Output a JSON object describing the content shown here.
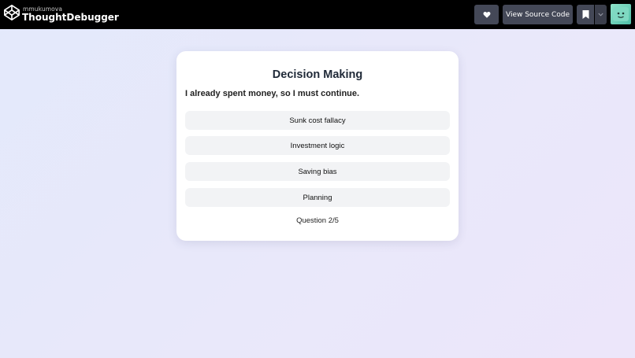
{
  "header": {
    "author": "mmukumova",
    "title": "ThoughtDebugger",
    "view_source_label": "View Source Code"
  },
  "card": {
    "title": "Decision Making",
    "question": "I already spent money, so I must continue.",
    "options": [
      {
        "label": "Sunk cost fallacy"
      },
      {
        "label": "Investment logic"
      },
      {
        "label": "Saving bias"
      },
      {
        "label": "Planning"
      }
    ],
    "progress": "Question 2/5"
  },
  "icons": {
    "logo": "codepen-logo-icon",
    "heart": "heart-icon",
    "bookmark": "bookmark-icon",
    "caret": "chevron-down-icon"
  },
  "colors": {
    "topbar": "#000000",
    "button": "#444857",
    "card": "#ffffff",
    "option": "#f2f3f5"
  }
}
